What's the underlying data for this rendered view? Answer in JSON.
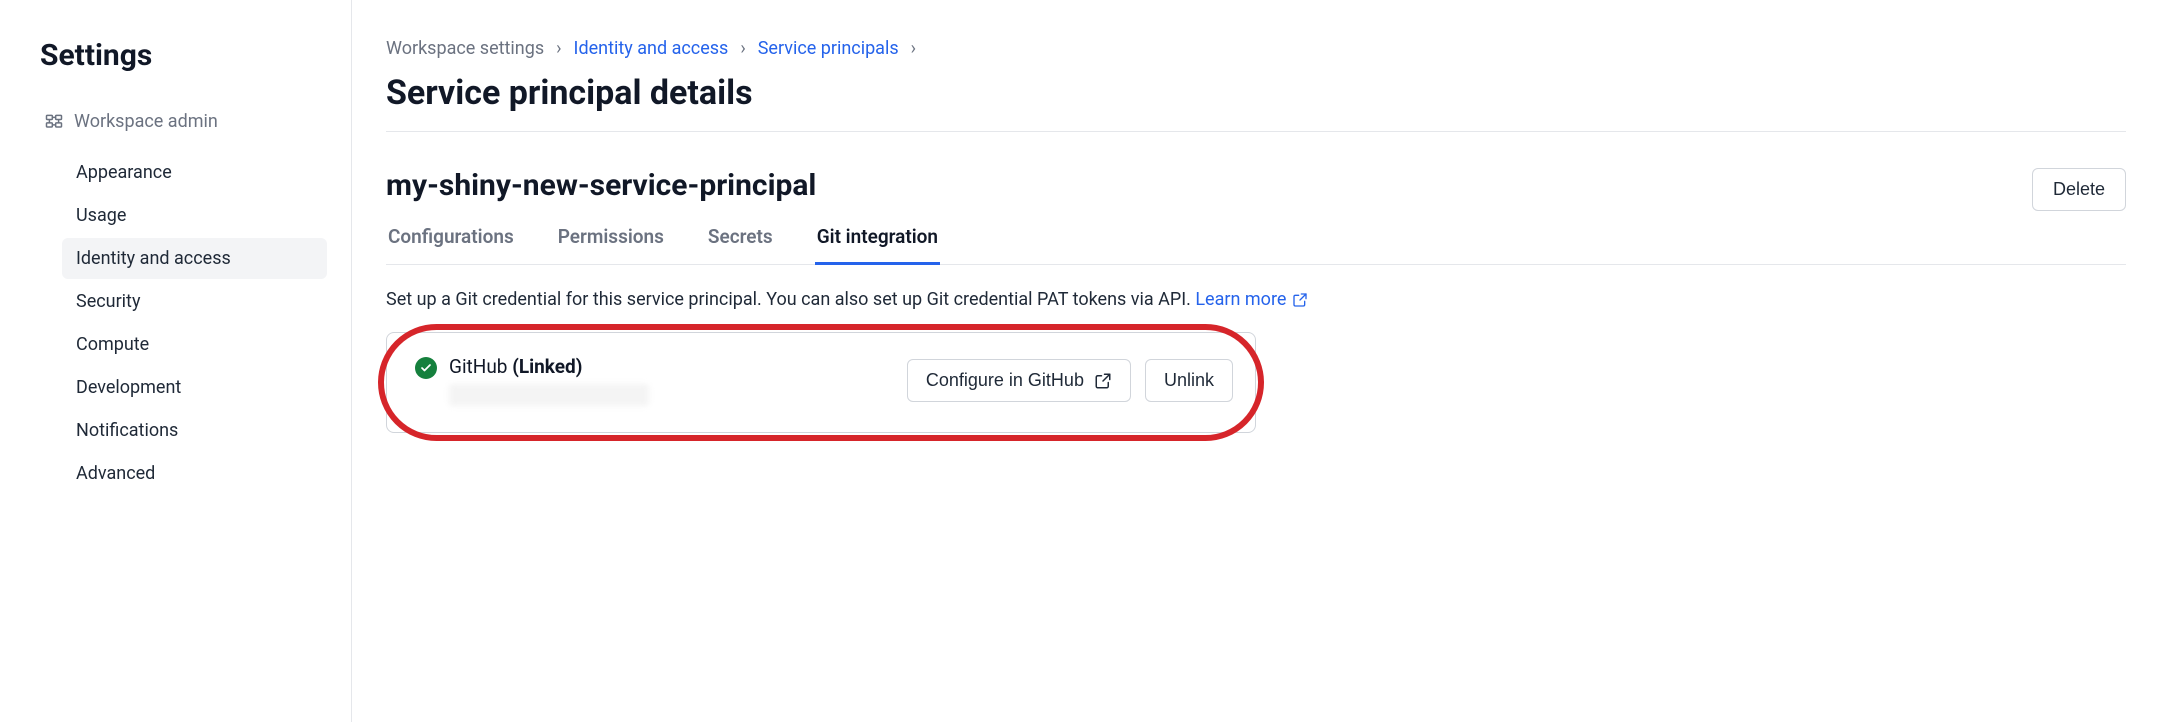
{
  "sidebar": {
    "title": "Settings",
    "section_label": "Workspace admin",
    "items": [
      {
        "label": "Appearance",
        "active": false
      },
      {
        "label": "Usage",
        "active": false
      },
      {
        "label": "Identity and access",
        "active": true
      },
      {
        "label": "Security",
        "active": false
      },
      {
        "label": "Compute",
        "active": false
      },
      {
        "label": "Development",
        "active": false
      },
      {
        "label": "Notifications",
        "active": false
      },
      {
        "label": "Advanced",
        "active": false
      }
    ]
  },
  "breadcrumb": {
    "items": [
      {
        "label": "Workspace settings",
        "link": false
      },
      {
        "label": "Identity and access",
        "link": true
      },
      {
        "label": "Service principals",
        "link": true
      }
    ]
  },
  "page": {
    "title": "Service principal details",
    "principal_name": "my-shiny-new-service-principal",
    "delete_label": "Delete"
  },
  "tabs": [
    {
      "label": "Configurations",
      "active": false
    },
    {
      "label": "Permissions",
      "active": false
    },
    {
      "label": "Secrets",
      "active": false
    },
    {
      "label": "Git integration",
      "active": true
    }
  ],
  "git": {
    "description_prefix": "Set up a Git credential for this service principal. You can also set up Git credential PAT tokens via API. ",
    "learn_more_label": "Learn more",
    "provider_name": "GitHub",
    "provider_status": "(Linked)",
    "configure_label": "Configure in GitHub",
    "unlink_label": "Unlink"
  },
  "colors": {
    "link": "#2563eb",
    "success": "#15803d",
    "annotation": "#d6252a"
  }
}
